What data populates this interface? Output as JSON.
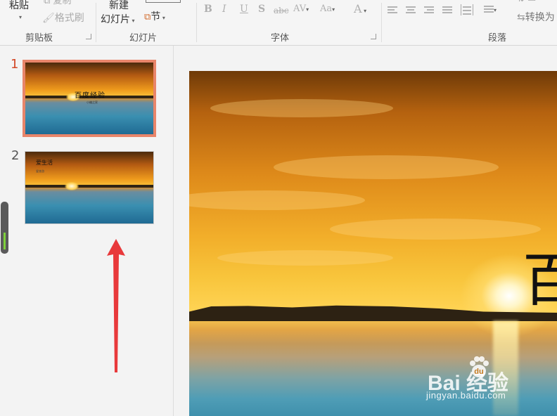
{
  "ribbon": {
    "clipboard": {
      "paste_label": "粘贴",
      "copy_label": "复制",
      "format_painter_label": "格式刷",
      "group_label": "剪贴板"
    },
    "slides": {
      "new_slide_line1": "新建",
      "new_slide_line2": "幻灯片",
      "section_label": "节",
      "group_label": "幻灯片"
    },
    "font": {
      "bold": "B",
      "italic": "I",
      "underline": "U",
      "shadow": "S",
      "strikethrough": "abc",
      "spacing": "AV",
      "change_case": "Aa",
      "font_color": "A",
      "group_label": "字体"
    },
    "paragraph": {
      "convert_label": "转换为",
      "group_label": "段落"
    }
  },
  "thumbnails": [
    {
      "number": "1",
      "title": "百度经验",
      "subtitle": "小编之家",
      "selected": true
    },
    {
      "number": "2",
      "title": "爱生活",
      "subtitle": "爱旅游",
      "selected": false
    }
  ],
  "slide": {
    "title_visible": "百"
  },
  "watermark": {
    "brand": "Bai  经验",
    "paw_text": "du",
    "url": "jingyan.baidu.com"
  },
  "colors": {
    "accent": "#d24726",
    "selection_border": "#e8856a",
    "arrow": "#e8393b"
  }
}
